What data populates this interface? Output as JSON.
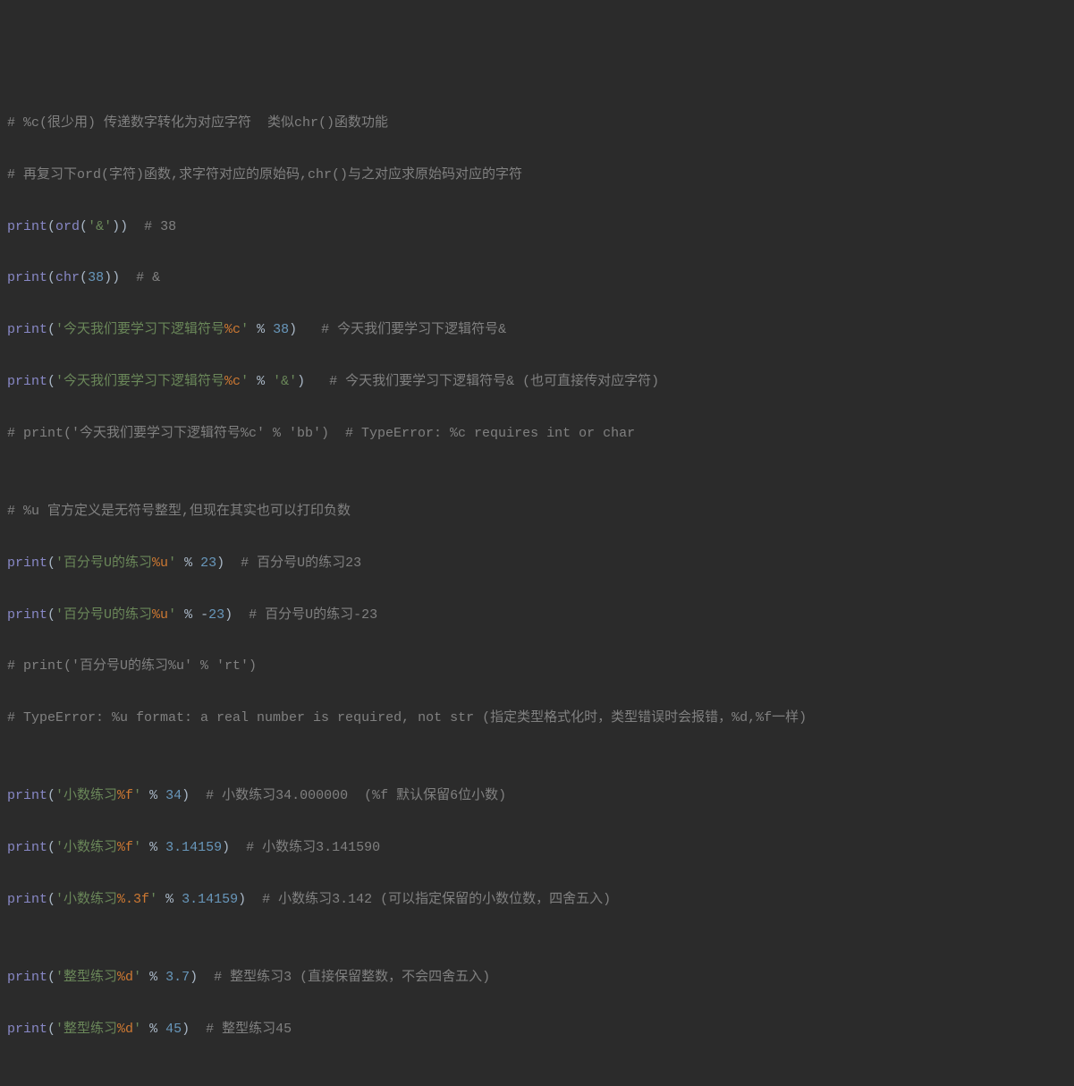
{
  "lines": {
    "l00_c": "# %c(很少用) 传递数字转化为对应字符  类似chr()函数功能",
    "l01_c": "# 再复习下ord(字符)函数,求字符对应的原始码,chr()与之对应求原始码对应的字符",
    "l02_fn": "print",
    "l02_p1": "(",
    "l02_ord": "ord",
    "l02_p2": "(",
    "l02_s": "'&'",
    "l02_p3": "))  ",
    "l02_c": "# 38",
    "l03_fn": "print",
    "l03_p1": "(",
    "l03_chr": "chr",
    "l03_p2": "(",
    "l03_n": "38",
    "l03_p3": "))  ",
    "l03_c": "# &",
    "l04_fn": "print",
    "l04_p1": "(",
    "l04_s1": "'今天我们要学习下逻辑符号",
    "l04_sf": "%c",
    "l04_s2": "'",
    "l04_op": " % ",
    "l04_n": "38",
    "l04_p2": ")   ",
    "l04_c": "# 今天我们要学习下逻辑符号&",
    "l05_fn": "print",
    "l05_p1": "(",
    "l05_s1": "'今天我们要学习下逻辑符号",
    "l05_sf": "%c",
    "l05_s2": "'",
    "l05_op": " % ",
    "l05_arg": "'&'",
    "l05_p2": ")   ",
    "l05_c": "# 今天我们要学习下逻辑符号& (也可直接传对应字符)",
    "l06_c": "# print('今天我们要学习下逻辑符号%c' % 'bb')  # TypeError: %c requires int or char",
    "l07_blank": "",
    "l08_c": "# %u 官方定义是无符号整型,但现在其实也可以打印负数",
    "l09_fn": "print",
    "l09_p1": "(",
    "l09_s1": "'百分号U的练习",
    "l09_sf": "%u",
    "l09_s2": "'",
    "l09_op": " % ",
    "l09_n": "23",
    "l09_p2": ")  ",
    "l09_c": "# 百分号U的练习23",
    "l10_fn": "print",
    "l10_p1": "(",
    "l10_s1": "'百分号U的练习",
    "l10_sf": "%u",
    "l10_s2": "'",
    "l10_op": " % -",
    "l10_n": "23",
    "l10_p2": ")  ",
    "l10_c": "# 百分号U的练习-23",
    "l11_c": "# print('百分号U的练习%u' % 'rt')",
    "l12_c": "# TypeError: %u format: a real number is required, not str (指定类型格式化时，类型错误时会报错，%d,%f一样)",
    "l13_blank": "",
    "l14_fn": "print",
    "l14_p1": "(",
    "l14_s1": "'小数练习",
    "l14_sf": "%f",
    "l14_s2": "'",
    "l14_op": " % ",
    "l14_n": "34",
    "l14_p2": ")  ",
    "l14_c": "# 小数练习34.000000  (%f 默认保留6位小数)",
    "l15_fn": "print",
    "l15_p1": "(",
    "l15_s1": "'小数练习",
    "l15_sf": "%f",
    "l15_s2": "'",
    "l15_op": " % ",
    "l15_n": "3.14159",
    "l15_p2": ")  ",
    "l15_c": "# 小数练习3.141590",
    "l16_fn": "print",
    "l16_p1": "(",
    "l16_s1": "'小数练习",
    "l16_sf": "%.3f",
    "l16_s2": "'",
    "l16_op": " % ",
    "l16_n": "3.14159",
    "l16_p2": ")  ",
    "l16_c": "# 小数练习3.142 (可以指定保留的小数位数，四舍五入)",
    "l17_blank": "",
    "l18_fn": "print",
    "l18_p1": "(",
    "l18_s1": "'整型练习",
    "l18_sf": "%d",
    "l18_s2": "'",
    "l18_op": " % ",
    "l18_n": "3.7",
    "l18_p2": ")  ",
    "l18_c": "# 整型练习3 (直接保留整数，不会四舍五入)",
    "l19_fn": "print",
    "l19_p1": "(",
    "l19_s1": "'整型练习",
    "l19_sf": "%d",
    "l19_s2": "'",
    "l19_op": " % ",
    "l19_n": "45",
    "l19_p2": ")  ",
    "l19_c": "# 整型练习45"
  }
}
